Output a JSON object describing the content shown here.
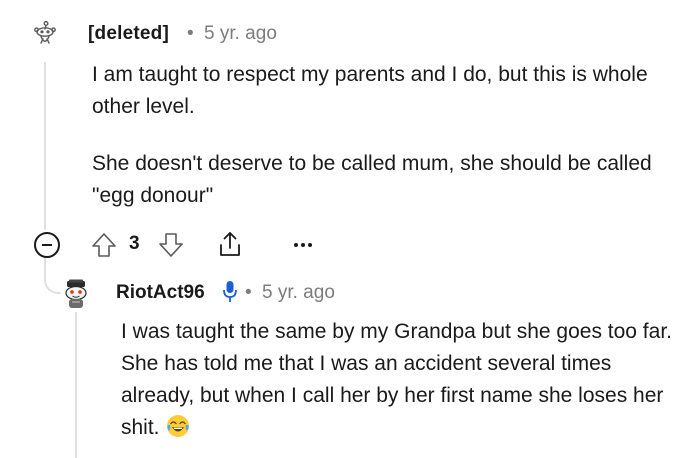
{
  "comment_1": {
    "author": "[deleted]",
    "separator": "•",
    "time": "5 yr. ago",
    "paragraphs": [
      "I am taught to respect my parents and I do, but this is whole other level.",
      "She doesn't deserve to be called mum, she should be called \"egg donour\""
    ],
    "vote_count": "3"
  },
  "comment_2": {
    "author": "RiotAct96",
    "separator": "•",
    "time": "5 yr. ago",
    "body": "I was taught the same by my Grandpa but she goes too far. She has told me that I was an accident several times already, but when I call her by her first name she loses her shit.",
    "emoji": "face-with-tears-of-joy"
  },
  "icons": {
    "deleted_avatar": "snoo-outline-avatar-icon",
    "collapse": "collapse-minus-icon",
    "upvote": "upvote-arrow-icon",
    "downvote": "downvote-arrow-icon",
    "share": "share-icon",
    "more": "more-dots-icon",
    "riot_avatar": "snoo-avatar-icon",
    "mic": "microphone-icon"
  },
  "colors": {
    "text": "#1a1a1b",
    "meta": "#7c7c7c",
    "thread_line": "#e0e0e0",
    "mic_blue": "#1a5fd6"
  }
}
